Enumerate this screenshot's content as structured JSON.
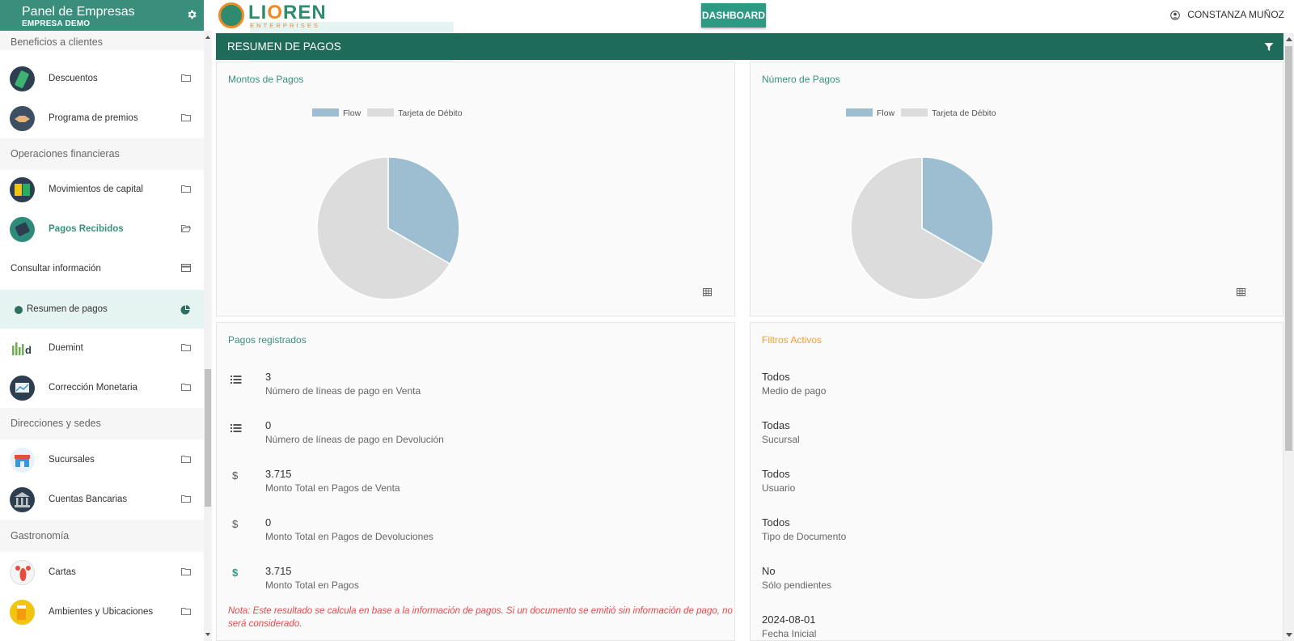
{
  "sidebar": {
    "title": "Panel de Empresas",
    "subtitle": "EMPRESA DEMO",
    "sections": {
      "s1": "Beneficios a clientes",
      "s2": "Operaciones financieras",
      "s3": "Direcciones y sedes",
      "s4": "Gastronomía"
    },
    "items": {
      "descuentos": "Descuentos",
      "premios": "Programa de premios",
      "capital": "Movimientos de capital",
      "pagos": "Pagos Recibidos",
      "consultar": "Consultar información",
      "resumen": "Resumen de pagos",
      "duemint": "Duemint",
      "correccion": "Corrección Monetaria",
      "sucursales": "Sucursales",
      "cuentas": "Cuentas Bancarias",
      "cartas": "Cartas",
      "ambientes": "Ambientes y Ubicaciones"
    }
  },
  "topbar": {
    "logo_main_a": "LI",
    "logo_main_o": "O",
    "logo_main_b": "REN",
    "logo_sub": "ENTERPRISES",
    "dashboard_label": "DASHBOARD",
    "user_name": "CONSTANZA MUÑOZ"
  },
  "main": {
    "title": "RESUMEN DE PAGOS",
    "panel_montos": "Montos de Pagos",
    "panel_numero": "Número de Pagos",
    "panel_registrados": "Pagos registrados",
    "panel_filtros": "Filtros Activos",
    "stats": [
      {
        "value": "3",
        "label": "Número de líneas de pago en Venta"
      },
      {
        "value": "0",
        "label": "Número de líneas de pago en Devolución"
      },
      {
        "value": "3.715",
        "label": "Monto Total en Pagos de Venta"
      },
      {
        "value": "0",
        "label": "Monto Total en Pagos de Devoluciones"
      },
      {
        "value": "3.715",
        "label": "Monto Total en Pagos"
      }
    ],
    "filters": [
      {
        "value": "Todos",
        "label": "Medio de pago"
      },
      {
        "value": "Todas",
        "label": "Sucursal"
      },
      {
        "value": "Todos",
        "label": "Usuario"
      },
      {
        "value": "Todos",
        "label": "Tipo de Documento"
      },
      {
        "value": "No",
        "label": "Sólo pendientes"
      },
      {
        "value": "2024-08-01",
        "label": "Fecha Inicial"
      }
    ],
    "note": "Nota: Este resultado se calcula en base a la información de pagos. Si un documento se emitió sin información de pago, no será considerado.",
    "dollar_symbol": "$"
  },
  "colors": {
    "header_green": "#3a8f7c",
    "title_bar": "#1f6b59",
    "flow": "#9dbdd0",
    "debito": "#dcdcdc",
    "accent_orange": "#f0a030",
    "note_red": "#e34a4a"
  },
  "chart_data": [
    {
      "type": "pie",
      "legend": [
        "Flow",
        "Tarjeta de Débito"
      ],
      "values": [
        1,
        2
      ],
      "colors": [
        "#9dbdd0",
        "#dcdcdc"
      ]
    },
    {
      "type": "pie",
      "legend": [
        "Flow",
        "Tarjeta de Débito"
      ],
      "values": [
        1,
        2
      ],
      "colors": [
        "#9dbdd0",
        "#dcdcdc"
      ]
    }
  ]
}
